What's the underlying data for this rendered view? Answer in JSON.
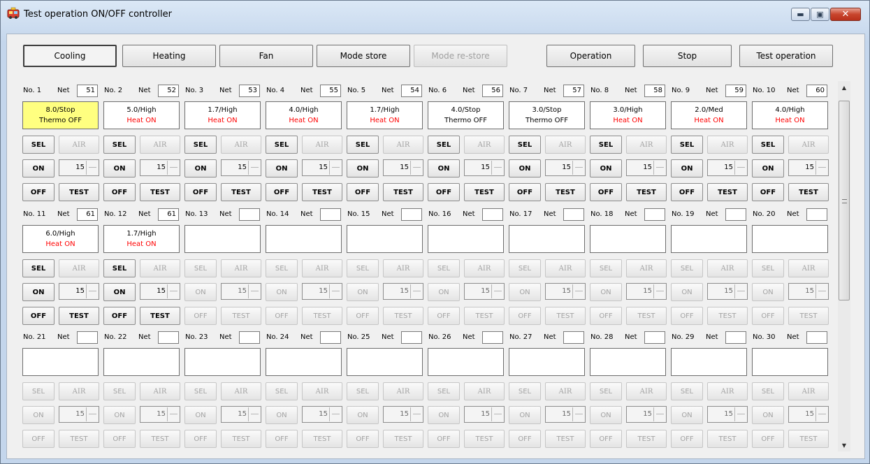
{
  "window": {
    "title": "Test operation ON/OFF controller",
    "minimize": "▬",
    "maximize": "▣",
    "close": "✕"
  },
  "mode_buttons": [
    {
      "label": "Cooling",
      "state": "pressed"
    },
    {
      "label": "Heating",
      "state": "normal"
    },
    {
      "label": "Fan",
      "state": "normal"
    },
    {
      "label": "Mode store",
      "state": "normal"
    },
    {
      "label": "Mode re-store",
      "state": "disabled"
    },
    {
      "label": "Operation",
      "state": "normal"
    },
    {
      "label": "Stop",
      "state": "normal"
    },
    {
      "label": "Test operation",
      "state": "normal"
    }
  ],
  "labels": {
    "net": "Net",
    "sel": "SEL",
    "air": "AIR",
    "on": "ON",
    "off": "OFF",
    "test": "TEST"
  },
  "units": [
    {
      "no": "No. 1",
      "net": "51",
      "l1": "8.0/Stop",
      "l2": "Thermo OFF",
      "red": false,
      "highlight": true,
      "active": true,
      "spin": "15"
    },
    {
      "no": "No. 2",
      "net": "52",
      "l1": "5.0/High",
      "l2": "Heat ON",
      "red": true,
      "highlight": false,
      "active": true,
      "spin": "15"
    },
    {
      "no": "No. 3",
      "net": "53",
      "l1": "1.7/High",
      "l2": "Heat ON",
      "red": true,
      "highlight": false,
      "active": true,
      "spin": "15"
    },
    {
      "no": "No. 4",
      "net": "55",
      "l1": "4.0/High",
      "l2": "Heat ON",
      "red": true,
      "highlight": false,
      "active": true,
      "spin": "15"
    },
    {
      "no": "No. 5",
      "net": "54",
      "l1": "1.7/High",
      "l2": "Heat ON",
      "red": true,
      "highlight": false,
      "active": true,
      "spin": "15"
    },
    {
      "no": "No. 6",
      "net": "56",
      "l1": "4.0/Stop",
      "l2": "Thermo OFF",
      "red": false,
      "highlight": false,
      "active": true,
      "spin": "15"
    },
    {
      "no": "No. 7",
      "net": "57",
      "l1": "3.0/Stop",
      "l2": "Thermo OFF",
      "red": false,
      "highlight": false,
      "active": true,
      "spin": "15"
    },
    {
      "no": "No. 8",
      "net": "58",
      "l1": "3.0/High",
      "l2": "Heat ON",
      "red": true,
      "highlight": false,
      "active": true,
      "spin": "15"
    },
    {
      "no": "No. 9",
      "net": "59",
      "l1": "2.0/Med",
      "l2": "Heat ON",
      "red": true,
      "highlight": false,
      "active": true,
      "spin": "15"
    },
    {
      "no": "No. 10",
      "net": "60",
      "l1": "4.0/High",
      "l2": "Heat ON",
      "red": true,
      "highlight": false,
      "active": true,
      "spin": "15"
    },
    {
      "no": "No. 11",
      "net": "61",
      "l1": "6.0/High",
      "l2": "Heat ON",
      "red": true,
      "highlight": false,
      "active": true,
      "spin": "15"
    },
    {
      "no": "No. 12",
      "net": "61",
      "l1": "1.7/High",
      "l2": "Heat ON",
      "red": true,
      "highlight": false,
      "active": true,
      "spin": "15"
    },
    {
      "no": "No. 13",
      "net": "",
      "l1": "",
      "l2": "",
      "red": false,
      "highlight": false,
      "active": false,
      "spin": "15"
    },
    {
      "no": "No. 14",
      "net": "",
      "l1": "",
      "l2": "",
      "red": false,
      "highlight": false,
      "active": false,
      "spin": "15"
    },
    {
      "no": "No. 15",
      "net": "",
      "l1": "",
      "l2": "",
      "red": false,
      "highlight": false,
      "active": false,
      "spin": "15"
    },
    {
      "no": "No. 16",
      "net": "",
      "l1": "",
      "l2": "",
      "red": false,
      "highlight": false,
      "active": false,
      "spin": "15"
    },
    {
      "no": "No. 17",
      "net": "",
      "l1": "",
      "l2": "",
      "red": false,
      "highlight": false,
      "active": false,
      "spin": "15"
    },
    {
      "no": "No. 18",
      "net": "",
      "l1": "",
      "l2": "",
      "red": false,
      "highlight": false,
      "active": false,
      "spin": "15"
    },
    {
      "no": "No. 19",
      "net": "",
      "l1": "",
      "l2": "",
      "red": false,
      "highlight": false,
      "active": false,
      "spin": "15"
    },
    {
      "no": "No. 20",
      "net": "",
      "l1": "",
      "l2": "",
      "red": false,
      "highlight": false,
      "active": false,
      "spin": "15"
    },
    {
      "no": "No. 21",
      "net": "",
      "l1": "",
      "l2": "",
      "red": false,
      "highlight": false,
      "active": false,
      "spin": "15"
    },
    {
      "no": "No. 22",
      "net": "",
      "l1": "",
      "l2": "",
      "red": false,
      "highlight": false,
      "active": false,
      "spin": "15"
    },
    {
      "no": "No. 23",
      "net": "",
      "l1": "",
      "l2": "",
      "red": false,
      "highlight": false,
      "active": false,
      "spin": "15"
    },
    {
      "no": "No. 24",
      "net": "",
      "l1": "",
      "l2": "",
      "red": false,
      "highlight": false,
      "active": false,
      "spin": "15"
    },
    {
      "no": "No. 25",
      "net": "",
      "l1": "",
      "l2": "",
      "red": false,
      "highlight": false,
      "active": false,
      "spin": "15"
    },
    {
      "no": "No. 26",
      "net": "",
      "l1": "",
      "l2": "",
      "red": false,
      "highlight": false,
      "active": false,
      "spin": "15"
    },
    {
      "no": "No. 27",
      "net": "",
      "l1": "",
      "l2": "",
      "red": false,
      "highlight": false,
      "active": false,
      "spin": "15"
    },
    {
      "no": "No. 28",
      "net": "",
      "l1": "",
      "l2": "",
      "red": false,
      "highlight": false,
      "active": false,
      "spin": "15"
    },
    {
      "no": "No. 29",
      "net": "",
      "l1": "",
      "l2": "",
      "red": false,
      "highlight": false,
      "active": false,
      "spin": "15"
    },
    {
      "no": "No. 30",
      "net": "",
      "l1": "",
      "l2": "",
      "red": false,
      "highlight": false,
      "active": false,
      "spin": "15"
    }
  ],
  "scrollbar": {
    "up": "▲",
    "down": "▼"
  }
}
